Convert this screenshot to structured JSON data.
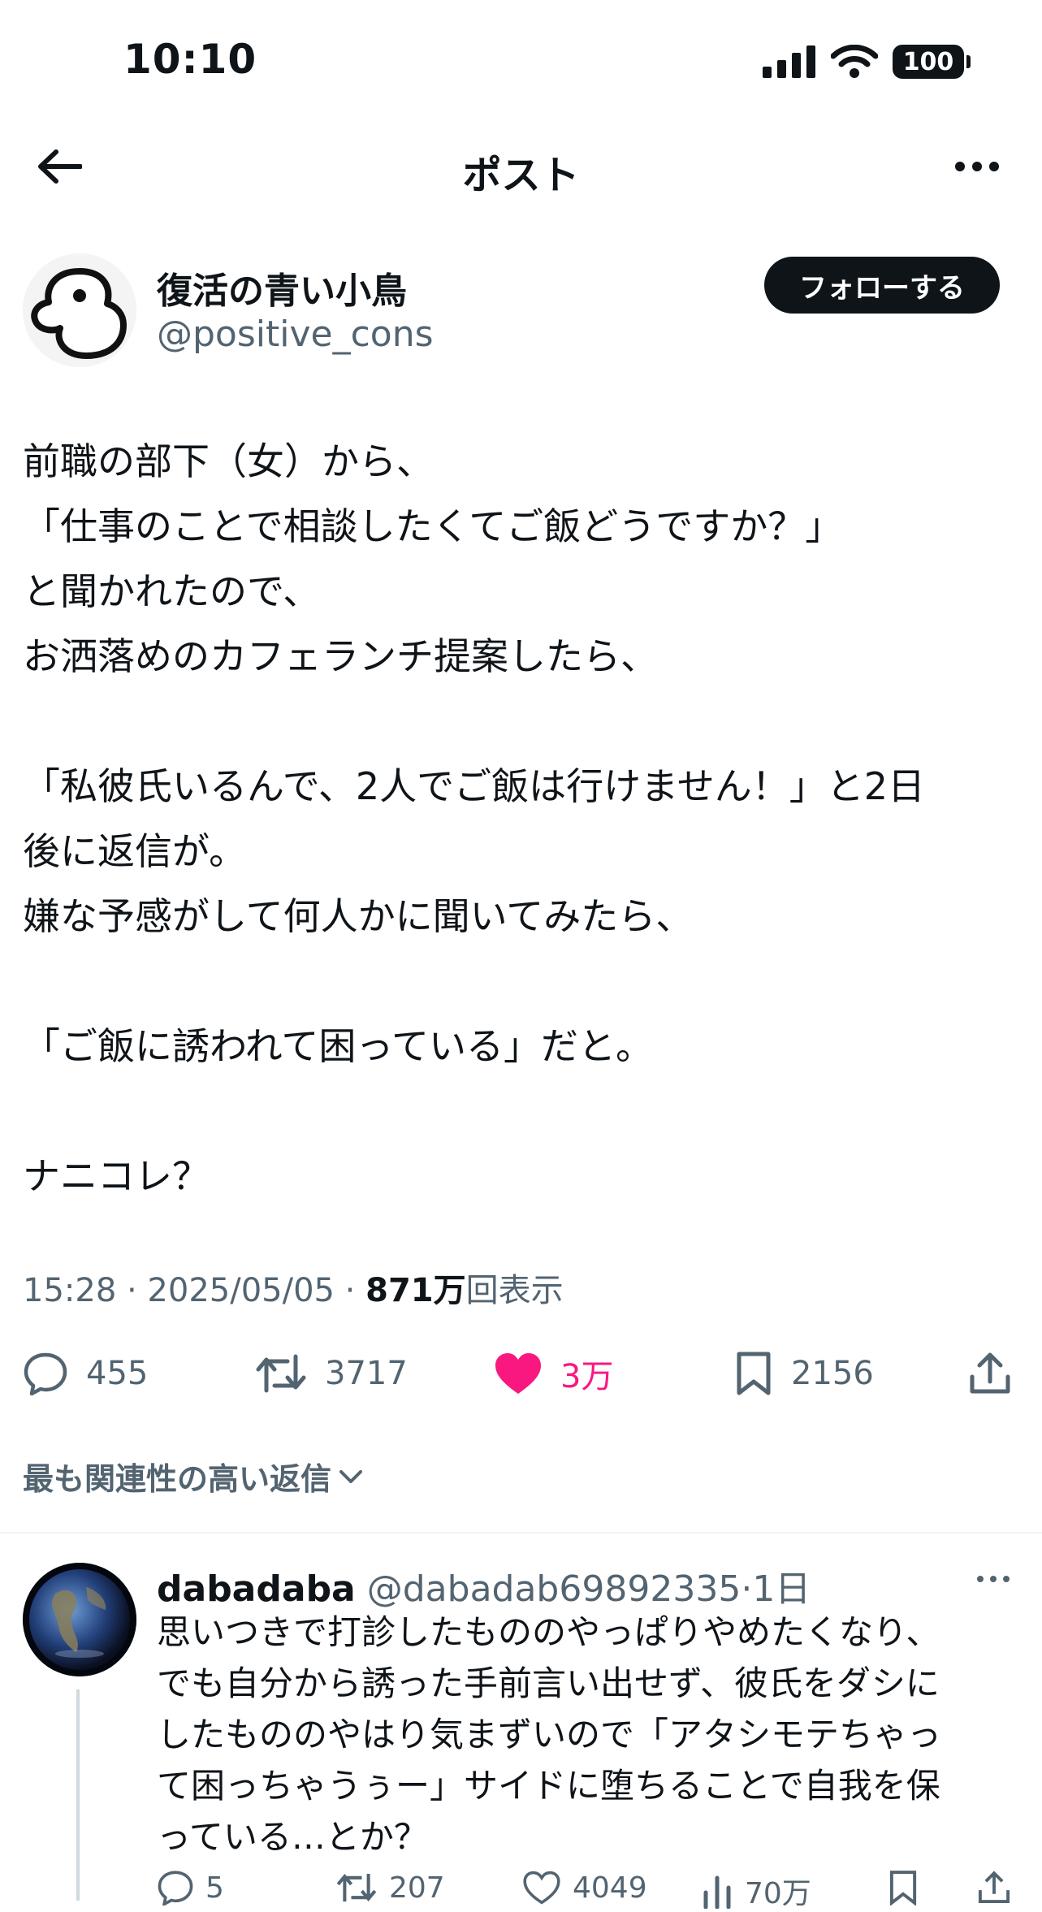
{
  "status_bar": {
    "time": "10:10",
    "battery": "100"
  },
  "nav": {
    "title": "ポスト"
  },
  "author": {
    "display_name": "復活の青い小鳥",
    "handle": "@positive_cons",
    "follow_label": "フォローする"
  },
  "post": {
    "lines": [
      "前職の部下（女）から、",
      "「仕事のことで相談したくてご飯どうですか？」",
      "と聞かれたので、",
      "お洒落めのカフェランチ提案したら、",
      "",
      "「私彼氏いるんで、2人でご飯は行けません！」と2日",
      "後に返信が。",
      "嫌な予感がして何人かに聞いてみたら、",
      "",
      "「ご飯に誘われて困っている」だと。",
      "",
      "ナニコレ？"
    ],
    "timestamp": "15:28 · 2025/05/05 · ",
    "views_count": "871万",
    "views_label": "回表示"
  },
  "actions": {
    "replies": "455",
    "reposts": "3717",
    "likes": "3万",
    "bookmarks": "2156"
  },
  "colors": {
    "like": "#f91880",
    "secondary": "#536471",
    "text": "#0f1419"
  },
  "replies_filter": {
    "label": "最も関連性の高い返信"
  },
  "reply": {
    "name": "dabadaba",
    "handle": "@dabadab69892335",
    "dot": "·",
    "time": "1日",
    "lines": [
      "思いつきで打診したもののやっぱりやめたくなり、",
      "でも自分から誘った手前言い出せず、彼氏をダシに",
      "したもののやはり気まずいので「アタシモテちゃっ",
      "て困っちゃうぅー」サイドに堕ちることで自我を保",
      "っている…とか？"
    ],
    "stats": {
      "replies": "5",
      "reposts": "207",
      "likes": "4049",
      "views": "70万"
    }
  }
}
